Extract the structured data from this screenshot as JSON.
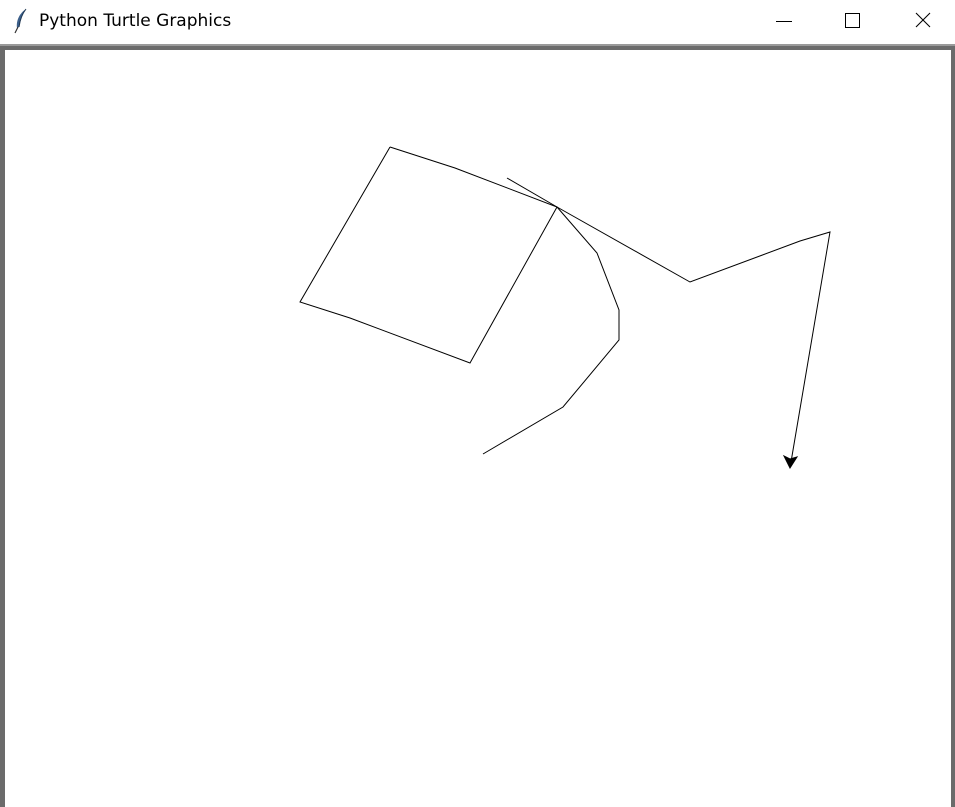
{
  "window": {
    "title": "Python Turtle Graphics",
    "icon": "feather-icon",
    "controls": {
      "minimize": "minimize-icon",
      "maximize": "maximize-icon",
      "close": "close-icon"
    }
  },
  "canvas": {
    "background": "#ffffff",
    "pen_color": "#000000",
    "turtle_shape": "arrow"
  }
}
